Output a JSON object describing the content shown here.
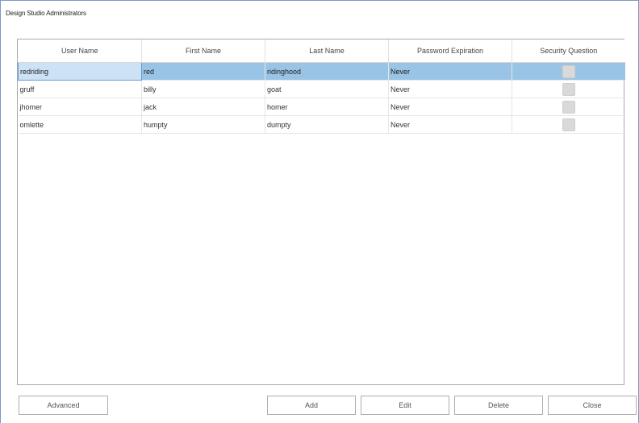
{
  "window": {
    "title": "Design Studio Administrators"
  },
  "grid": {
    "columns": [
      "User Name",
      "First Name",
      "Last Name",
      "Password Expiration",
      "Security Question"
    ],
    "rows": [
      {
        "user_name": "redriding",
        "first_name": "red",
        "last_name": "ridinghood",
        "password_expiration": "Never",
        "security_question": false,
        "selected": true
      },
      {
        "user_name": "gruff",
        "first_name": "billy",
        "last_name": "goat",
        "password_expiration": "Never",
        "security_question": false,
        "selected": false
      },
      {
        "user_name": "jhomer",
        "first_name": "jack",
        "last_name": "homer",
        "password_expiration": "Never",
        "security_question": false,
        "selected": false
      },
      {
        "user_name": "omlette",
        "first_name": "humpty",
        "last_name": "dumpty",
        "password_expiration": "Never",
        "security_question": false,
        "selected": false
      }
    ]
  },
  "buttons": {
    "advanced": "Advanced",
    "add": "Add",
    "edit": "Edit",
    "delete": "Delete",
    "close": "Close"
  }
}
